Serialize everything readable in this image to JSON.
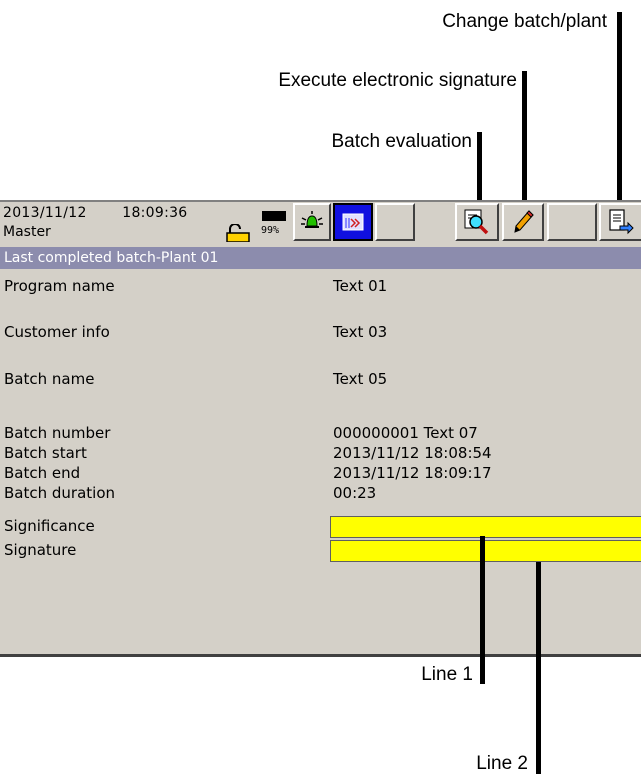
{
  "callouts": {
    "change_batch_plant": "Change batch/plant",
    "execute_signature": "Execute electronic signature",
    "batch_evaluation": "Batch evaluation",
    "line1": "Line 1",
    "line2": "Line 2"
  },
  "status_bar": {
    "date": "2013/11/12",
    "time": "18:09:36",
    "user": "Master",
    "memory_percent": "99%"
  },
  "toolbar": {
    "icons": [
      "memory-icon",
      "alarm-bell-icon",
      "recording-icon",
      "magnifier-icon",
      "pencil-icon",
      "export-icon"
    ]
  },
  "panel": {
    "title": "Last completed batch-Plant 01",
    "rows": [
      {
        "label": "Program name",
        "value": "Text 01"
      },
      {
        "label": "Customer info",
        "value": "Text 03"
      },
      {
        "label": "Batch name",
        "value": "Text 05"
      },
      {
        "label": "Batch number",
        "value": "000000001 Text 07"
      },
      {
        "label": "Batch start",
        "value": "2013/11/12 18:08:54"
      },
      {
        "label": "Batch end",
        "value": "2013/11/12 18:09:17"
      },
      {
        "label": "Batch duration",
        "value": "00:23"
      }
    ],
    "signature_fields": {
      "significance_label": "Significance",
      "signature_label": "Signature",
      "significance_value": "",
      "signature_value": ""
    }
  },
  "colors": {
    "screen_bg": "#d4d0c8",
    "header_bar": "#8c8cad",
    "input_highlight": "#ffff00",
    "active_button": "#1010e0"
  }
}
